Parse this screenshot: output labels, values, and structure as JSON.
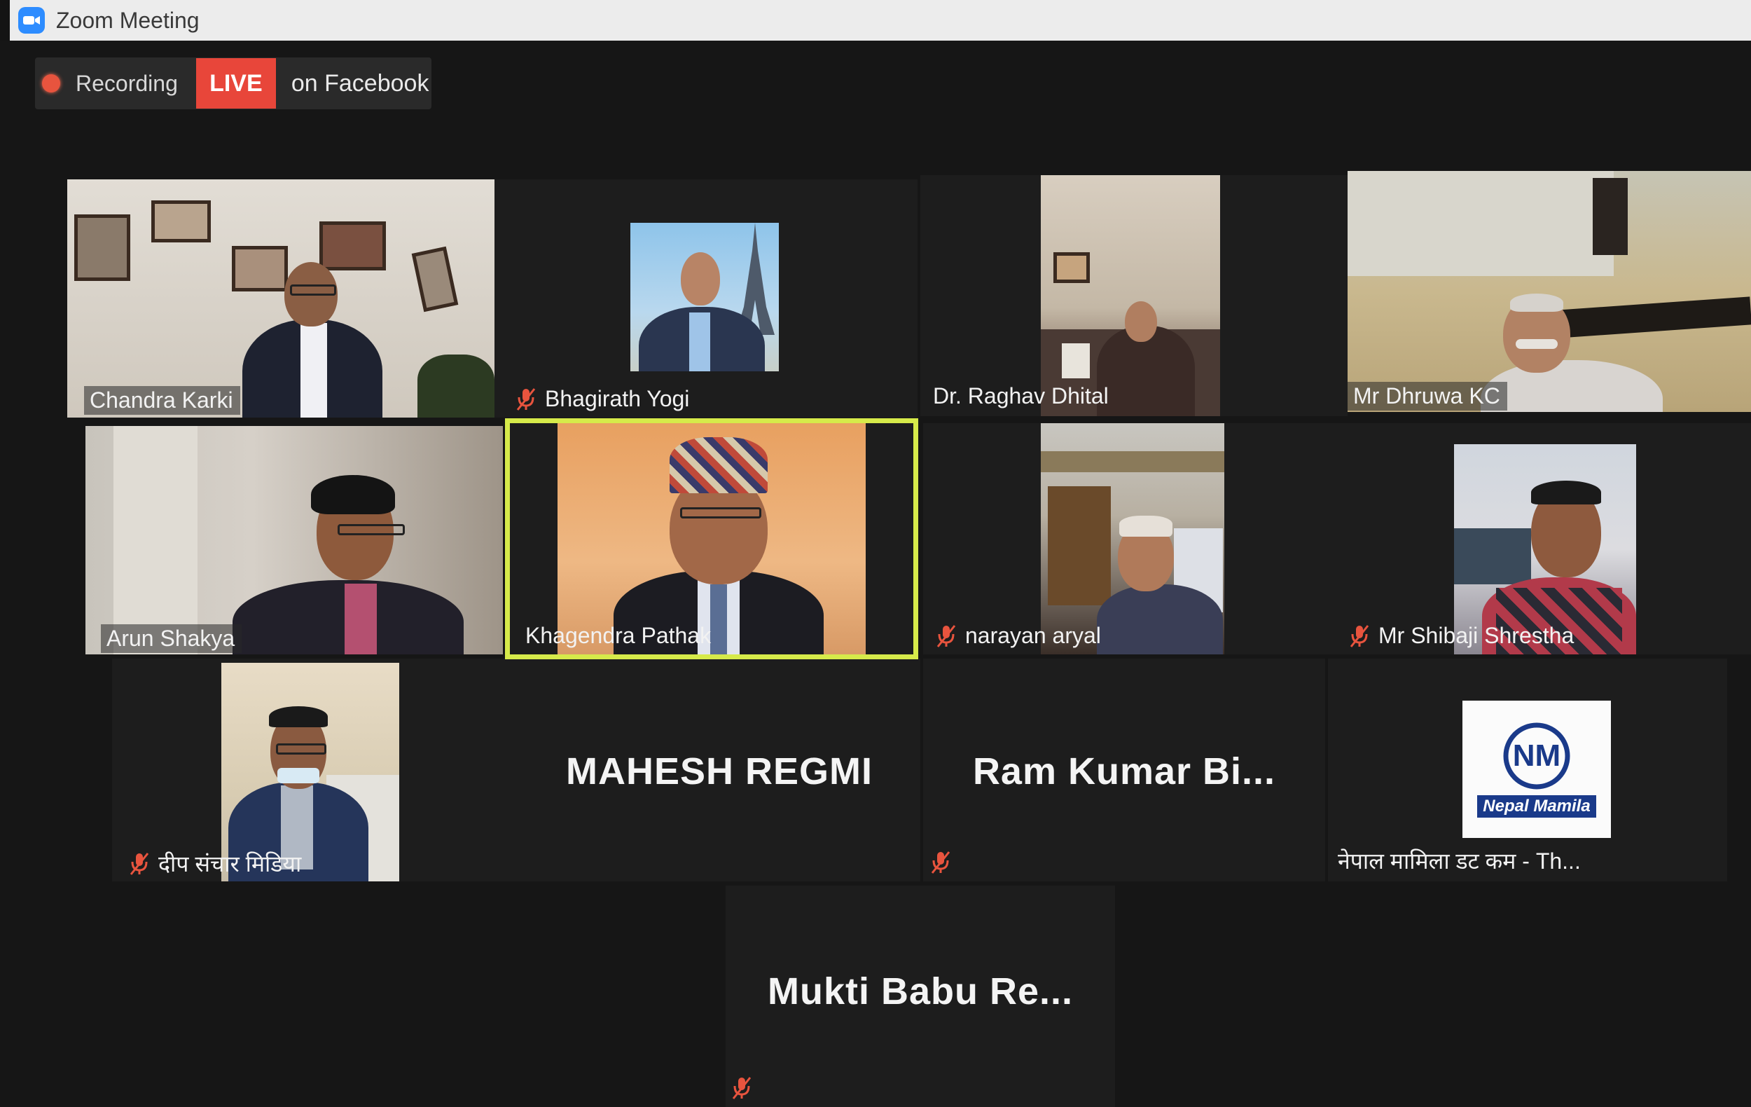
{
  "window": {
    "title": "Zoom Meeting"
  },
  "recording": {
    "label": "Recording",
    "live_badge": "LIVE",
    "live_target": "on Facebook"
  },
  "participants": [
    {
      "name": "Chandra Karki",
      "muted": false,
      "video": true
    },
    {
      "name": "Bhagirath Yogi",
      "muted": true,
      "video": true
    },
    {
      "name": "Dr. Raghav Dhital",
      "muted": false,
      "video": true
    },
    {
      "name": "Mr Dhruwa KC",
      "muted": false,
      "video": true
    },
    {
      "name": "Arun Shakya",
      "muted": false,
      "video": true
    },
    {
      "name": "Khagendra Pathak",
      "muted": false,
      "video": true,
      "active_speaker": true
    },
    {
      "name": "narayan aryal",
      "muted": true,
      "video": true
    },
    {
      "name": "Mr Shibaji Shrestha",
      "muted": true,
      "video": true
    },
    {
      "name": "दीप संचार मिडिया",
      "muted": true,
      "video": true
    },
    {
      "name": "MAHESH REGMI",
      "muted": false,
      "video": false
    },
    {
      "name": "Ram Kumar Bi...",
      "muted": true,
      "video": false
    },
    {
      "name": "नेपाल मामिला डट कम - Th...",
      "muted": false,
      "video": true,
      "logo_text": "Nepal Mamila",
      "logo_initials": "NM"
    },
    {
      "name": "Mukti Babu Re...",
      "muted": true,
      "video": false
    }
  ],
  "colors": {
    "active_speaker_border": "#d6ea4a",
    "live_red": "#e8463a",
    "mute_red": "#e8543e",
    "zoom_blue": "#2d8cff"
  }
}
